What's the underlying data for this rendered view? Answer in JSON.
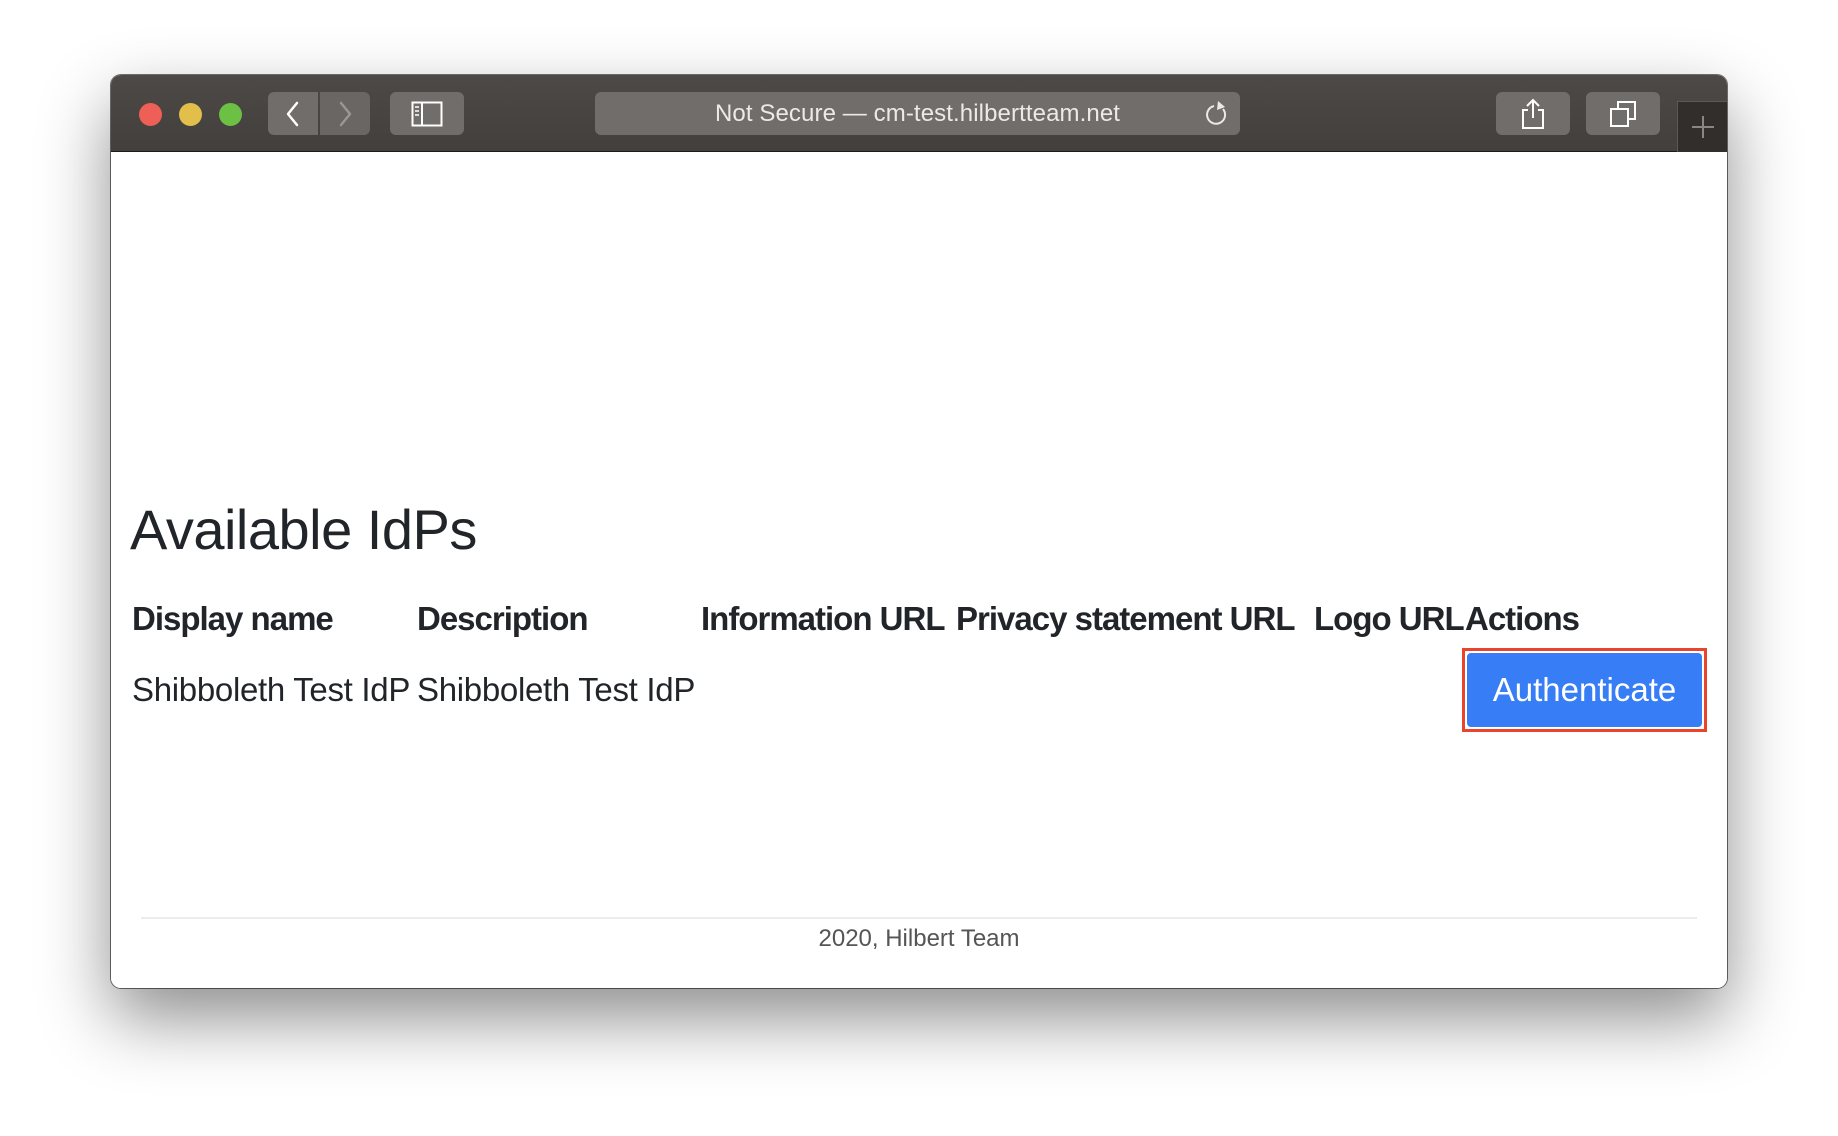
{
  "browser": {
    "address_bar": "Not Secure — cm-test.hilbertteam.net",
    "icons": {
      "back": "chevron-left-icon",
      "forward": "chevron-right-icon",
      "sidebar": "sidebar-icon",
      "reload": "reload-icon",
      "share": "share-icon",
      "tabs": "tabs-overview-icon",
      "new_tab": "plus-icon"
    }
  },
  "page": {
    "title": "Available IdPs",
    "table": {
      "headers": [
        "Display name",
        "Description",
        "Information URL",
        "Privacy statement URL",
        "Logo URL",
        "Actions"
      ],
      "rows": [
        {
          "display_name": "Shibboleth Test IdP",
          "description": "Shibboleth Test IdP",
          "information_url": "",
          "privacy_statement_url": "",
          "logo_url": "",
          "action_label": "Authenticate"
        }
      ]
    },
    "footer": "2020, Hilbert Team"
  },
  "colors": {
    "primary_button": "#377df6",
    "highlight_outline": "#e8452c"
  }
}
